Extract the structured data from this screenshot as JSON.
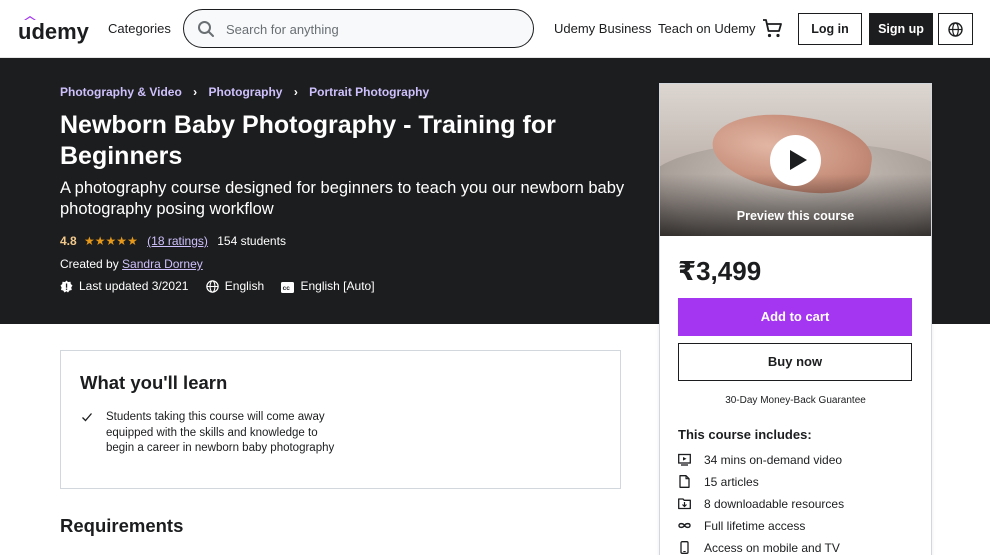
{
  "header": {
    "logo_text": "udemy",
    "categories_label": "Categories",
    "search_placeholder": "Search for anything",
    "search_value": "",
    "business_label": "Udemy Business",
    "teach_label": "Teach on Udemy",
    "login_label": "Log in",
    "signup_label": "Sign up"
  },
  "breadcrumb": [
    "Photography & Video",
    "Photography",
    "Portrait Photography"
  ],
  "course": {
    "title": "Newborn Baby Photography - Training for Beginners",
    "subtitle": "A photography course designed for beginners to teach you our newborn baby photography posing workflow",
    "rating": "4.8",
    "stars": "★★★★★",
    "ratings_count": "(18 ratings)",
    "students": "154 students",
    "created_by_prefix": "Created by",
    "instructor": "Sandra Dorney",
    "last_updated": "Last updated 3/2021",
    "language": "English",
    "captions": "English [Auto]"
  },
  "card": {
    "preview_label": "Preview this course",
    "price": "₹3,499",
    "add_to_cart": "Add to cart",
    "buy_now": "Buy now",
    "guarantee": "30-Day Money-Back Guarantee",
    "includes_title": "This course includes:",
    "includes": [
      {
        "icon": "video-icon",
        "label": "34 mins on-demand video"
      },
      {
        "icon": "article-icon",
        "label": "15 articles"
      },
      {
        "icon": "download-icon",
        "label": "8 downloadable resources"
      },
      {
        "icon": "infinity-icon",
        "label": "Full lifetime access"
      },
      {
        "icon": "mobile-icon",
        "label": "Access on mobile and TV"
      }
    ]
  },
  "learn": {
    "title": "What you'll learn",
    "items": [
      "Students taking this course will come away equipped with the skills and knowledge to begin a career in newborn baby photography"
    ]
  },
  "requirements": {
    "title": "Requirements"
  },
  "colors": {
    "dark_bg": "#1c1d1f",
    "accent_purple": "#a435f0",
    "link_purple": "#cec0fc",
    "rating_gold": "#f3ca8c",
    "star_orange": "#e59819"
  }
}
